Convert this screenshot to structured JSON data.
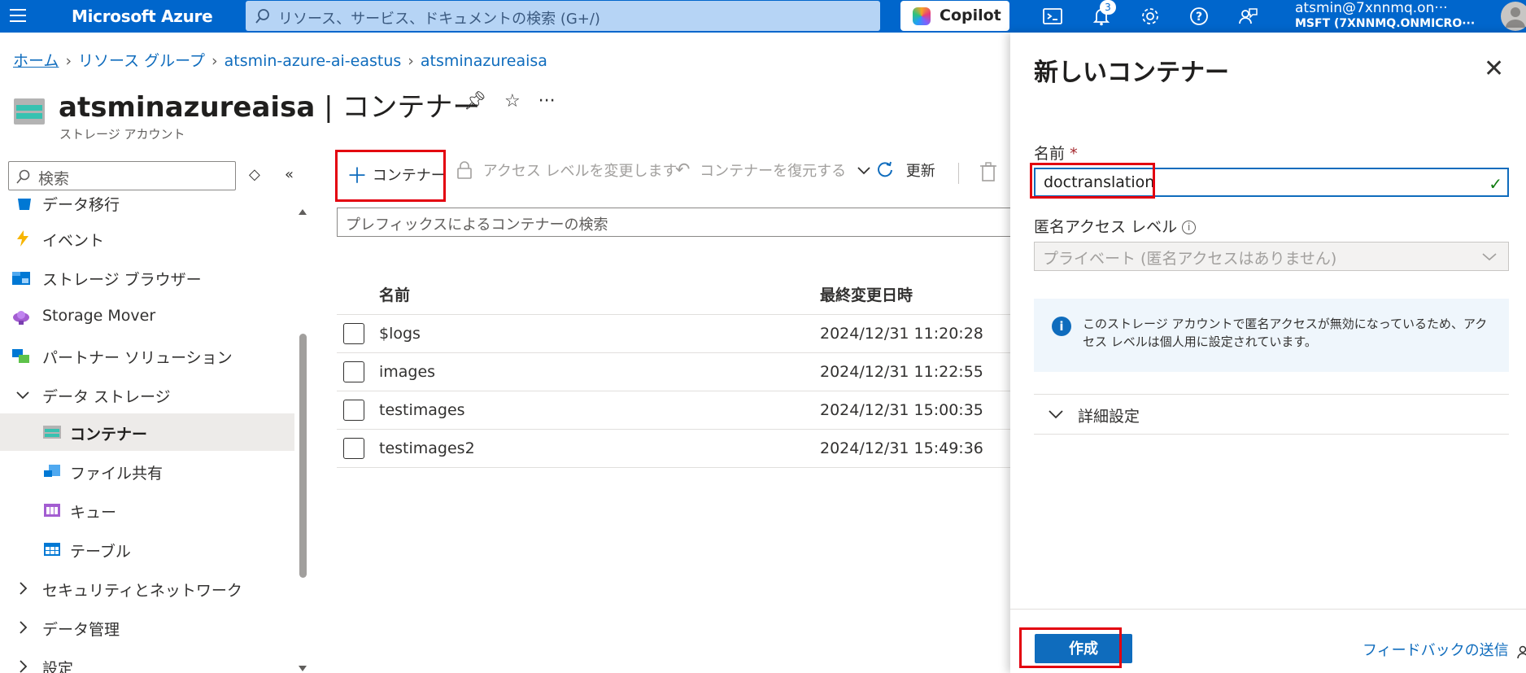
{
  "topbar": {
    "brand": "Microsoft Azure",
    "search_placeholder": "リソース、サービス、ドキュメントの検索 (G+/)",
    "copilot_label": "Copilot",
    "notification_count": "3",
    "user_email": "atsmin@7xnnmq.on···",
    "user_tenant": "MSFT (7XNNMQ.ONMICRO···"
  },
  "breadcrumb": [
    "ホーム",
    "リソース グループ",
    "atsmin-azure-ai-eastus",
    "atsminazureaisa"
  ],
  "page": {
    "title_main": "atsminazureaisa",
    "title_sep": " | ",
    "title_section": "コンテナー",
    "subtitle": "ストレージ アカウント",
    "more": "···"
  },
  "sidebar": {
    "search_placeholder": "検索",
    "items": [
      {
        "label": "データ移行",
        "icon": "data-migration-icon"
      },
      {
        "label": "イベント",
        "icon": "lightning-icon"
      },
      {
        "label": "ストレージ ブラウザー",
        "icon": "storage-browser-icon"
      },
      {
        "label": "Storage Mover",
        "icon": "cloud-icon"
      },
      {
        "label": "パートナー ソリューション",
        "icon": "partner-icon"
      },
      {
        "label": "データ ストレージ",
        "icon": "chevron-down-icon"
      },
      {
        "label": "コンテナー",
        "icon": "container-icon"
      },
      {
        "label": "ファイル共有",
        "icon": "file-share-icon"
      },
      {
        "label": "キュー",
        "icon": "queue-icon"
      },
      {
        "label": "テーブル",
        "icon": "table-icon"
      },
      {
        "label": "セキュリティとネットワーク",
        "icon": "chevron-right-icon"
      },
      {
        "label": "データ管理",
        "icon": "chevron-right-icon"
      },
      {
        "label": "設定",
        "icon": "chevron-right-icon"
      }
    ]
  },
  "toolbar": {
    "add_container": "コンテナー",
    "change_access": "アクセス レベルを変更します",
    "restore": "コンテナーを復元する",
    "refresh": "更新"
  },
  "prefix_search_placeholder": "プレフィックスによるコンテナーの検索",
  "table": {
    "headers": [
      "名前",
      "最終変更日時"
    ],
    "rows": [
      {
        "name": "$logs",
        "modified": "2024/12/31 11:20:28"
      },
      {
        "name": "images",
        "modified": "2024/12/31 11:22:55"
      },
      {
        "name": "testimages",
        "modified": "2024/12/31 15:00:35"
      },
      {
        "name": "testimages2",
        "modified": "2024/12/31 15:49:36"
      }
    ]
  },
  "panel": {
    "title": "新しいコンテナー",
    "name_label": "名前",
    "required_mark": "*",
    "name_value": "doctranslation",
    "access_label": "匿名アクセス レベル",
    "access_value": "プライベート (匿名アクセスはありません)",
    "info_text": "このストレージ アカウントで匿名アクセスが無効になっているため、アクセス レベルは個人用に設定されています。",
    "advanced": "詳細設定",
    "create_button": "作成",
    "feedback": "フィードバックの送信"
  },
  "colors": {
    "azure_blue": "#0066cc",
    "accent": "#0f6cbd",
    "highlight_red": "#e3000f"
  }
}
